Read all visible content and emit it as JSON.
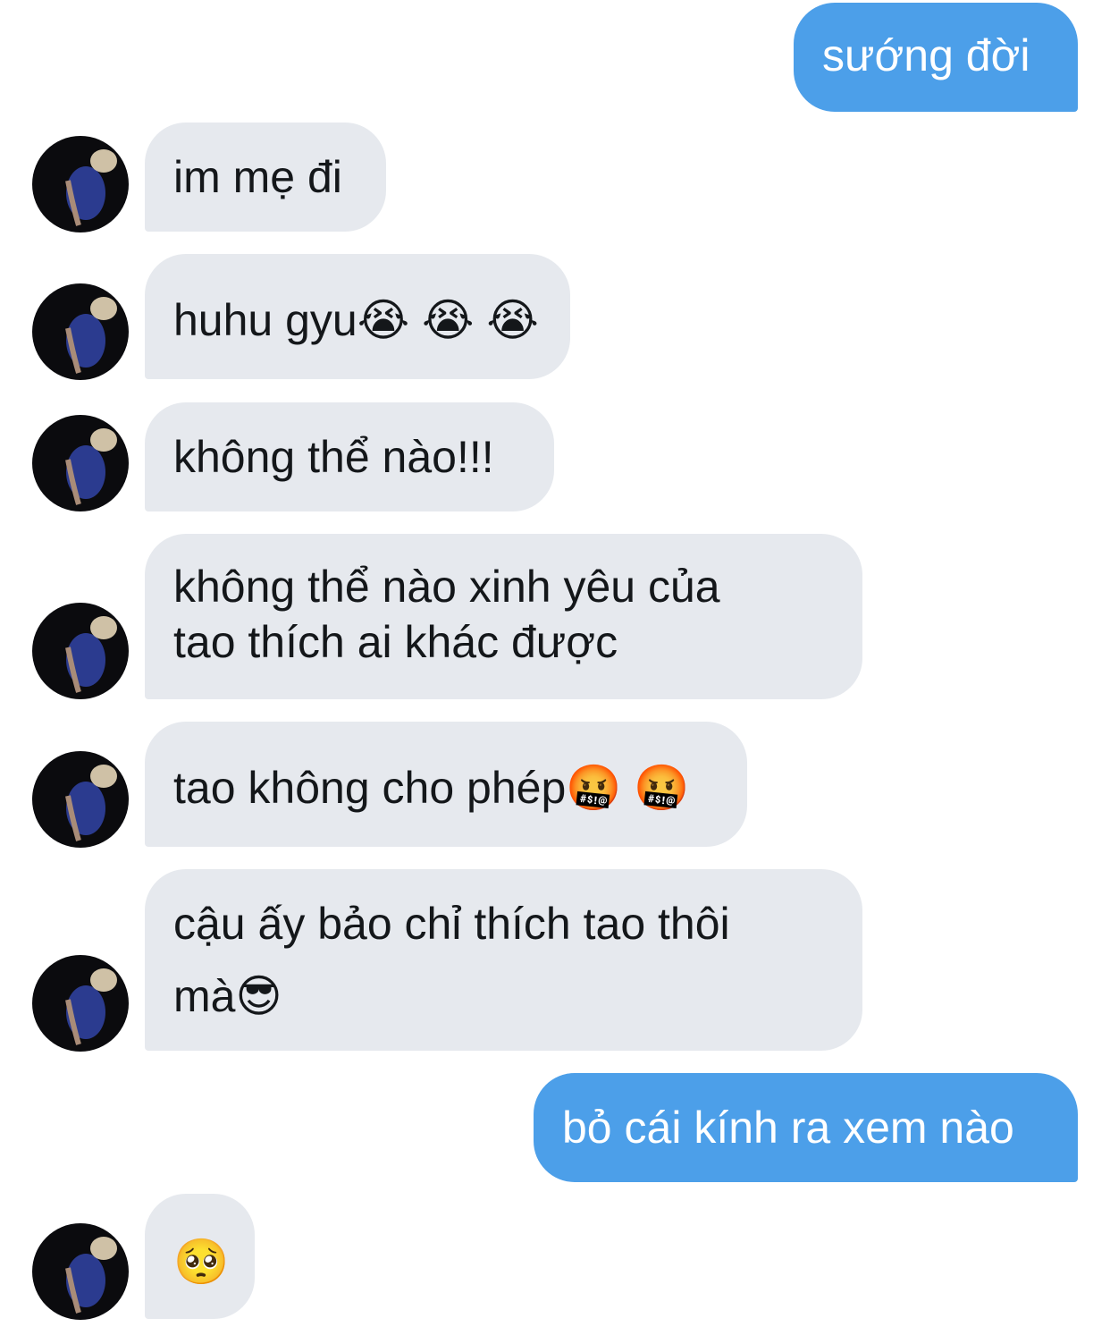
{
  "conversation": {
    "colors": {
      "outgoing_bubble": "#4c9fe9",
      "incoming_bubble": "#e6e9ee",
      "outgoing_text": "#ffffff",
      "incoming_text": "#14171a"
    },
    "messages": [
      {
        "direction": "outgoing",
        "text": "sướng đời"
      },
      {
        "direction": "incoming",
        "text": "im mẹ đi"
      },
      {
        "direction": "incoming",
        "text": "huhu gyu😭 😭 😭"
      },
      {
        "direction": "incoming",
        "text": "không thể nào!!!"
      },
      {
        "direction": "incoming",
        "lines": [
          "không thể nào xinh yêu của",
          "tao thích ai khác được"
        ]
      },
      {
        "direction": "incoming",
        "text": "tao không cho phép🤬 🤬"
      },
      {
        "direction": "incoming",
        "lines": [
          "cậu ấy bảo chỉ thích tao thôi",
          "mà😎"
        ]
      },
      {
        "direction": "outgoing",
        "text": "bỏ cái kính ra xem nào"
      },
      {
        "direction": "incoming",
        "text": "🥺"
      }
    ]
  }
}
